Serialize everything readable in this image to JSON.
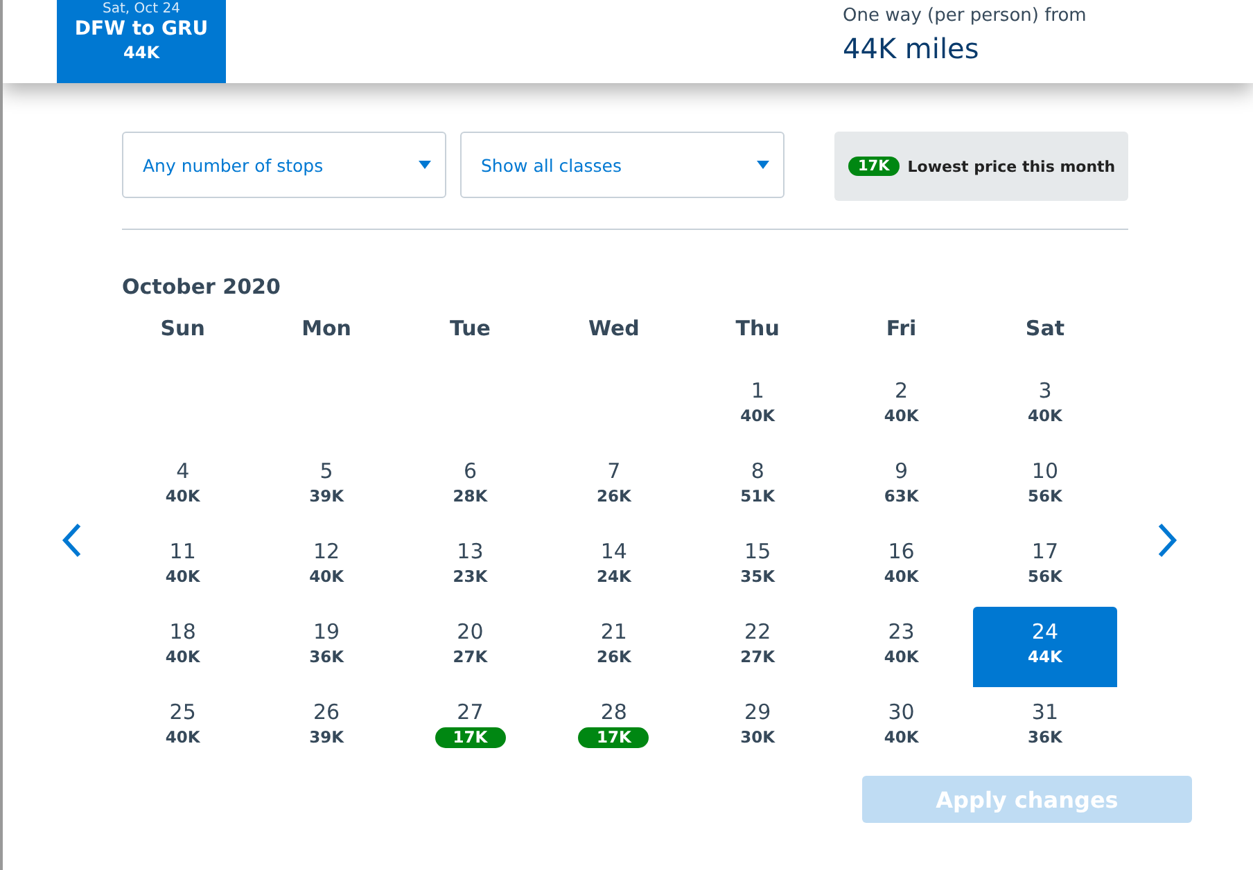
{
  "header": {
    "tab": {
      "date": "Sat, Oct 24",
      "route": "DFW to GRU",
      "price": "44K",
      "selected": true
    },
    "fare_label": "One way (per person) from",
    "fare_value": "44K miles"
  },
  "filters": [
    {
      "value": "Any number of stops"
    },
    {
      "value": "Show all classes"
    }
  ],
  "legend": {
    "badge": "17K",
    "text": "Lowest price this month"
  },
  "calendar": {
    "month": "October 2020",
    "weekdays": [
      "Sun",
      "Mon",
      "Tue",
      "Wed",
      "Thu",
      "Fri",
      "Sat"
    ],
    "weeks": [
      [
        {
          "kind": "empty"
        },
        {
          "kind": "empty"
        },
        {
          "kind": "empty"
        },
        {
          "kind": "empty"
        },
        {
          "kind": "day",
          "day": "1",
          "price": "40K",
          "selected": false,
          "lowest": false
        },
        {
          "kind": "day",
          "day": "2",
          "price": "40K",
          "selected": false,
          "lowest": false
        },
        {
          "kind": "day",
          "day": "3",
          "price": "40K",
          "selected": false,
          "lowest": false
        }
      ],
      [
        {
          "kind": "day",
          "day": "4",
          "price": "40K",
          "selected": false,
          "lowest": false
        },
        {
          "kind": "day",
          "day": "5",
          "price": "39K",
          "selected": false,
          "lowest": false
        },
        {
          "kind": "day",
          "day": "6",
          "price": "28K",
          "selected": false,
          "lowest": false
        },
        {
          "kind": "day",
          "day": "7",
          "price": "26K",
          "selected": false,
          "lowest": false
        },
        {
          "kind": "day",
          "day": "8",
          "price": "51K",
          "selected": false,
          "lowest": false
        },
        {
          "kind": "day",
          "day": "9",
          "price": "63K",
          "selected": false,
          "lowest": false
        },
        {
          "kind": "day",
          "day": "10",
          "price": "56K",
          "selected": false,
          "lowest": false
        }
      ],
      [
        {
          "kind": "day",
          "day": "11",
          "price": "40K",
          "selected": false,
          "lowest": false
        },
        {
          "kind": "day",
          "day": "12",
          "price": "40K",
          "selected": false,
          "lowest": false
        },
        {
          "kind": "day",
          "day": "13",
          "price": "23K",
          "selected": false,
          "lowest": false
        },
        {
          "kind": "day",
          "day": "14",
          "price": "24K",
          "selected": false,
          "lowest": false
        },
        {
          "kind": "day",
          "day": "15",
          "price": "35K",
          "selected": false,
          "lowest": false
        },
        {
          "kind": "day",
          "day": "16",
          "price": "40K",
          "selected": false,
          "lowest": false
        },
        {
          "kind": "day",
          "day": "17",
          "price": "56K",
          "selected": false,
          "lowest": false
        }
      ],
      [
        {
          "kind": "day",
          "day": "18",
          "price": "40K",
          "selected": false,
          "lowest": false
        },
        {
          "kind": "day",
          "day": "19",
          "price": "36K",
          "selected": false,
          "lowest": false
        },
        {
          "kind": "day",
          "day": "20",
          "price": "27K",
          "selected": false,
          "lowest": false
        },
        {
          "kind": "day",
          "day": "21",
          "price": "26K",
          "selected": false,
          "lowest": false
        },
        {
          "kind": "day",
          "day": "22",
          "price": "27K",
          "selected": false,
          "lowest": false
        },
        {
          "kind": "day",
          "day": "23",
          "price": "40K",
          "selected": false,
          "lowest": false
        },
        {
          "kind": "day",
          "day": "24",
          "price": "44K",
          "selected": true,
          "lowest": false
        }
      ],
      [
        {
          "kind": "day",
          "day": "25",
          "price": "40K",
          "selected": false,
          "lowest": false
        },
        {
          "kind": "day",
          "day": "26",
          "price": "39K",
          "selected": false,
          "lowest": false
        },
        {
          "kind": "day",
          "day": "27",
          "price": "17K",
          "selected": false,
          "lowest": true
        },
        {
          "kind": "day",
          "day": "28",
          "price": "17K",
          "selected": false,
          "lowest": true
        },
        {
          "kind": "day",
          "day": "29",
          "price": "30K",
          "selected": false,
          "lowest": false
        },
        {
          "kind": "day",
          "day": "30",
          "price": "40K",
          "selected": false,
          "lowest": false
        },
        {
          "kind": "day",
          "day": "31",
          "price": "36K",
          "selected": false,
          "lowest": false
        }
      ]
    ]
  },
  "apply_button": {
    "label": "Apply changes",
    "disabled": true
  }
}
